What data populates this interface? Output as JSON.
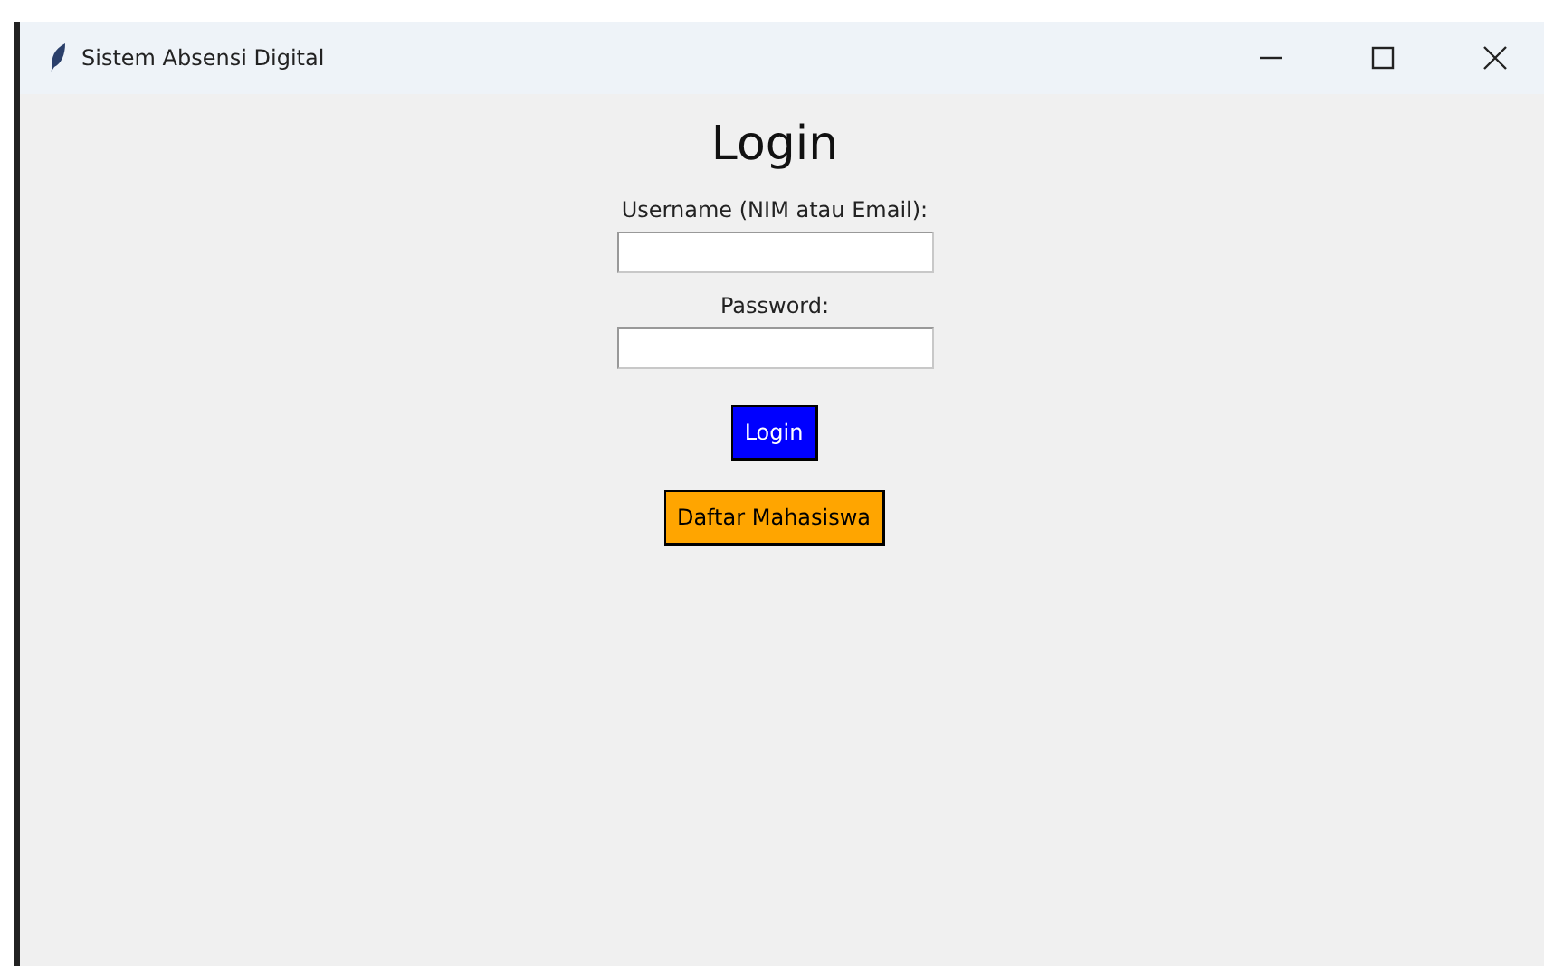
{
  "window": {
    "title": "Sistem Absensi Digital"
  },
  "heading": "Login",
  "fields": [
    {
      "label": "Username (NIM atau Email):"
    },
    {
      "label": "Password:"
    }
  ],
  "buttons": [
    {
      "label": "Login",
      "color": "#0000ff"
    },
    {
      "label": "Daftar Mahasiswa",
      "color": "#ffa500"
    }
  ]
}
